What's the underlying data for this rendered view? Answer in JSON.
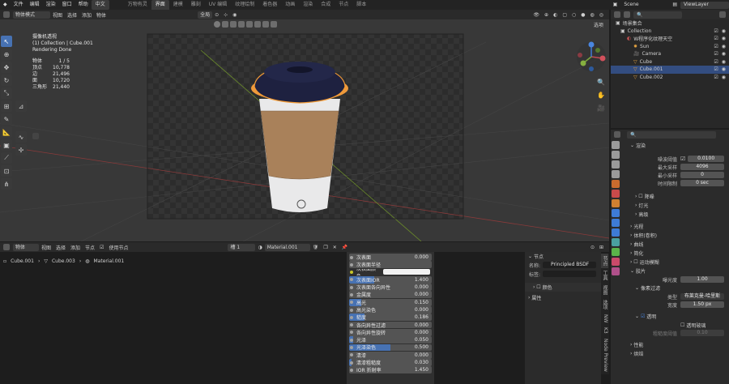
{
  "menubar": {
    "menus": [
      "文件",
      "编辑",
      "渲染",
      "窗口",
      "帮助"
    ],
    "lang": "中文",
    "workspaces": [
      "万物有灵",
      "界面",
      "建模",
      "雕刻",
      "UV 编辑",
      "纹理绘制",
      "着色器",
      "动画",
      "渲染",
      "合成",
      "节点",
      "脚本"
    ],
    "active_ws": "界面",
    "scene": "Scene",
    "viewlayer": "ViewLayer"
  },
  "viewport": {
    "mode": "物体模式",
    "menus": [
      "视图",
      "选择",
      "添加",
      "物体"
    ],
    "transform": "全局",
    "shading_label": "选项",
    "stats": {
      "title": "摄像机透视",
      "collection": "(1) Collection | Cube.001",
      "status": "Rendering Done",
      "rows": [
        {
          "k": "物体",
          "v": "1 / 5"
        },
        {
          "k": "顶点",
          "v": "10,778"
        },
        {
          "k": "边",
          "v": "21,496"
        },
        {
          "k": "面",
          "v": "10,720"
        },
        {
          "k": "三角形",
          "v": "21,440"
        }
      ]
    }
  },
  "outliner": {
    "title": "场景集合",
    "items": [
      {
        "label": "Collection",
        "sel": false
      },
      {
        "label": "W程序化纹理天空",
        "sel": false
      },
      {
        "label": "Sun",
        "sel": false
      },
      {
        "label": "Camera",
        "sel": false
      },
      {
        "label": "Cube",
        "sel": false
      },
      {
        "label": "Cube.001",
        "sel": true
      },
      {
        "label": "Cube.002",
        "sel": false
      }
    ]
  },
  "render": {
    "section": "渲染",
    "noise_label": "噪波阈值",
    "noise": "0.0100",
    "max_label": "最大采样",
    "max": "4096",
    "min_label": "最小采样",
    "min": "0",
    "time_label": "时间限制",
    "time": "0 sec",
    "sections": [
      "降噪",
      "灯光",
      "高级",
      "光程",
      "体积(卷积)",
      "曲线",
      "简化",
      "运动模糊",
      "胶片"
    ],
    "exposure_label": "曝光度",
    "exposure": "1.00",
    "pixel_filter": "像素过滤",
    "type_label": "类型",
    "type": "布莱克曼-哈里斯",
    "width_label": "宽度",
    "width": "1.50 px",
    "transparent": "透明",
    "glass": "透明玻璃",
    "roughness_label": "粗糙度阈值",
    "roughness": "0.10",
    "bottom": [
      "性能",
      "烘焙"
    ]
  },
  "node_editor": {
    "mode": "物体",
    "menus": [
      "视图",
      "选择",
      "添加",
      "节点"
    ],
    "use_nodes": "使用节点",
    "slot": "槽 1",
    "material": "Material.001",
    "breadcrumb": [
      "Cube.001",
      "Cube.003",
      "Material.001"
    ]
  },
  "shader_rows": [
    {
      "n": "次表面",
      "v": "0.000",
      "f": 0
    },
    {
      "n": "次表面半径",
      "v": "",
      "f": 0
    },
    {
      "n": "次表面颜色",
      "v": "",
      "f": 0
    },
    {
      "n": "次表面IOR",
      "v": "1.400",
      "f": 0.3
    },
    {
      "n": "次表面各向异性",
      "v": "0.000",
      "f": 0
    },
    {
      "n": "金属度",
      "v": "0.000",
      "f": 0
    },
    {
      "n": "高光",
      "v": "0.150",
      "f": 0.15
    },
    {
      "n": "高光染色",
      "v": "0.000",
      "f": 0
    },
    {
      "n": "糙度",
      "v": "0.186",
      "f": 0.186
    },
    {
      "n": "各向异性过滤",
      "v": "0.000",
      "f": 0
    },
    {
      "n": "各向异性旋转",
      "v": "0.000",
      "f": 0
    },
    {
      "n": "光泽",
      "v": "0.050",
      "f": 0.05
    },
    {
      "n": "光泽染色",
      "v": "0.500",
      "f": 0.5
    },
    {
      "n": "清漆",
      "v": "0.000",
      "f": 0
    },
    {
      "n": "清漆粗糙度",
      "v": "0.030",
      "f": 0.03
    },
    {
      "n": "IOR 折射率",
      "v": "1.450",
      "f": 0
    }
  ],
  "node_panel": {
    "section": "节点",
    "name_label": "名称:",
    "name": "Principled BSDF",
    "label_label": "标签:",
    "color": "颜色",
    "props": "属性",
    "tabs": [
      "节点",
      "工具",
      "视图",
      "选项",
      "NW",
      "K3",
      "Node Preview"
    ]
  },
  "colors": {
    "accent": "#4772b3",
    "bg": "#303030",
    "viewport": "#3d3d3d",
    "lid": "#1d1f38",
    "sleeve": "#b08358"
  }
}
